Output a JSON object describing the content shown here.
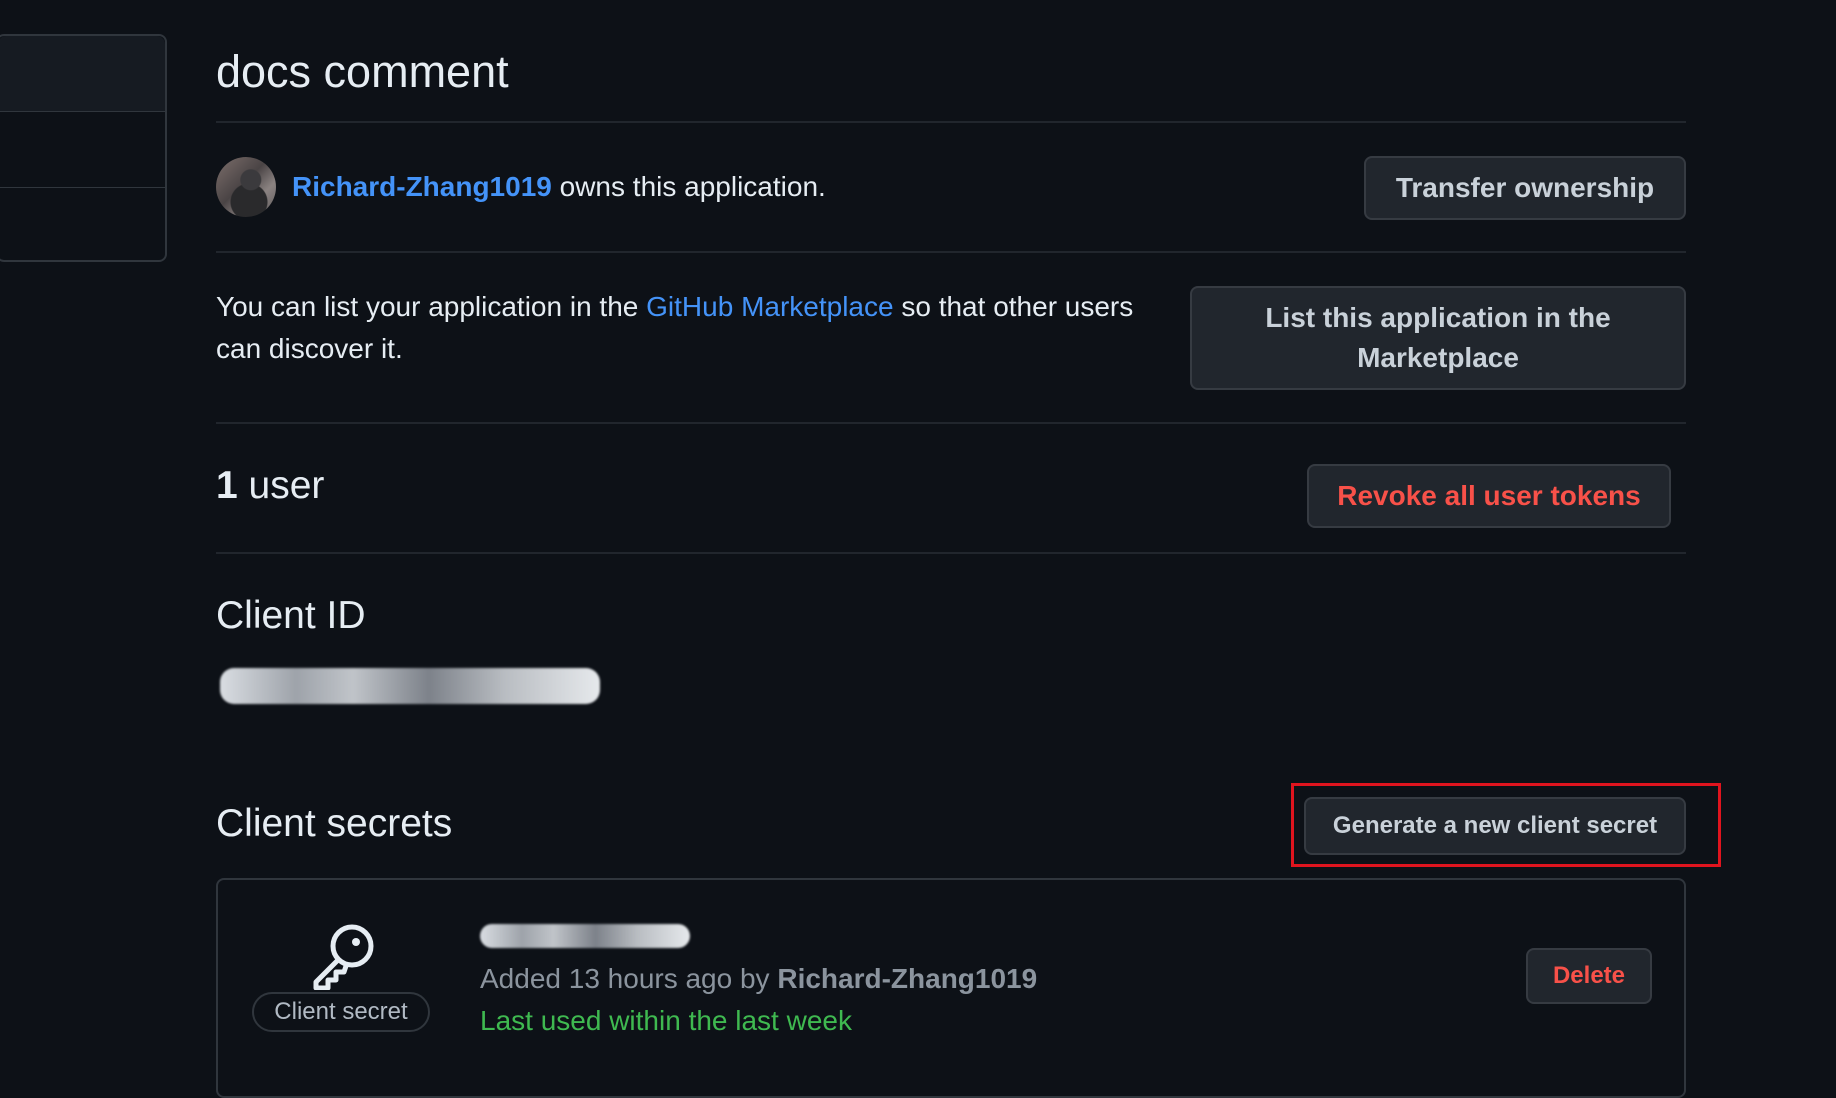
{
  "app": {
    "title": "docs comment"
  },
  "owner": {
    "username": "Richard-Zhang1019",
    "suffix": " owns this application.",
    "transfer_button": "Transfer ownership"
  },
  "marketplace": {
    "text_before": "You can list your application in the ",
    "link_text": "GitHub Marketplace",
    "text_after": " so that other users can discover it.",
    "list_button": "List this application in the Marketplace"
  },
  "users": {
    "count": "1",
    "label": " user",
    "revoke_button": "Revoke all user tokens"
  },
  "client_id": {
    "heading": "Client ID"
  },
  "client_secrets": {
    "heading": "Client secrets",
    "generate_button": "Generate a new client secret",
    "secret_badge": "Client secret",
    "added_prefix": "Added 13 hours ago by ",
    "added_by": "Richard-Zhang1019",
    "last_used": "Last used within the last week",
    "delete_button": "Delete"
  },
  "colors": {
    "background": "#0d1117",
    "link": "#4493f8",
    "danger": "#f85149",
    "success": "#3fb950",
    "highlight": "#e0141e"
  },
  "icons": {
    "key": "key-icon"
  }
}
